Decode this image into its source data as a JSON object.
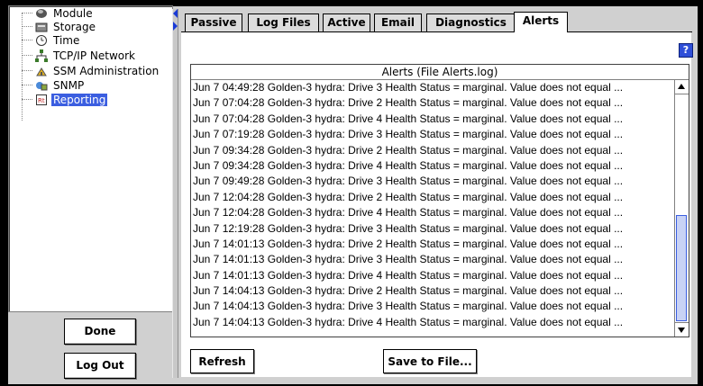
{
  "tree": {
    "items": [
      {
        "label": "Module",
        "icon": "module-icon"
      },
      {
        "label": "Storage",
        "icon": "storage-icon"
      },
      {
        "label": "Time",
        "icon": "clock-icon"
      },
      {
        "label": "TCP/IP Network",
        "icon": "network-icon"
      },
      {
        "label": "SSM Administration",
        "icon": "admin-icon"
      },
      {
        "label": "SNMP",
        "icon": "snmp-icon"
      },
      {
        "label": "Reporting",
        "icon": "report-icon",
        "selected": true
      }
    ]
  },
  "sidebar": {
    "done_label": "Done",
    "logout_label": "Log Out"
  },
  "tabs": [
    {
      "label": "Passive"
    },
    {
      "label": "Log Files"
    },
    {
      "label": "Active"
    },
    {
      "label": "Email"
    },
    {
      "label": "Diagnostics"
    },
    {
      "label": "Alerts",
      "active": true
    }
  ],
  "help_label": "?",
  "log": {
    "header": "Alerts (File Alerts.log)",
    "rows": [
      "Jun  7 04:49:28 Golden-3 hydra: Drive 3 Health Status = marginal. Value does not equal ...",
      "Jun  7 07:04:28 Golden-3 hydra: Drive 2 Health Status = marginal. Value does not equal ...",
      "Jun  7 07:04:28 Golden-3 hydra: Drive 4 Health Status = marginal. Value does not equal ...",
      "Jun  7 07:19:28 Golden-3 hydra: Drive 3 Health Status = marginal. Value does not equal ...",
      "Jun  7 09:34:28 Golden-3 hydra: Drive 2 Health Status = marginal. Value does not equal ...",
      "Jun  7 09:34:28 Golden-3 hydra: Drive 4 Health Status = marginal. Value does not equal ...",
      "Jun  7 09:49:28 Golden-3 hydra: Drive 3 Health Status = marginal. Value does not equal ...",
      "Jun  7 12:04:28 Golden-3 hydra: Drive 2 Health Status = marginal. Value does not equal ...",
      "Jun  7 12:04:28 Golden-3 hydra: Drive 4 Health Status = marginal. Value does not equal ...",
      "Jun  7 12:19:28 Golden-3 hydra: Drive 3 Health Status = marginal. Value does not equal ...",
      "Jun  7 14:01:13 Golden-3 hydra: Drive 2 Health Status = marginal. Value does not equal ...",
      "Jun  7 14:01:13 Golden-3 hydra: Drive 3 Health Status = marginal. Value does not equal ...",
      "Jun  7 14:01:13 Golden-3 hydra: Drive 4 Health Status = marginal. Value does not equal ...",
      "Jun  7 14:04:13 Golden-3 hydra: Drive 2 Health Status = marginal. Value does not equal ...",
      "Jun  7 14:04:13 Golden-3 hydra: Drive 3 Health Status = marginal. Value does not equal ...",
      "Jun  7 14:04:13 Golden-3 hydra: Drive 4 Health Status = marginal. Value does not equal ..."
    ]
  },
  "actions": {
    "refresh_label": "Refresh",
    "save_label": "Save to File..."
  },
  "colors": {
    "selection": "#3b5ee0",
    "accent": "#1a3ad6"
  }
}
